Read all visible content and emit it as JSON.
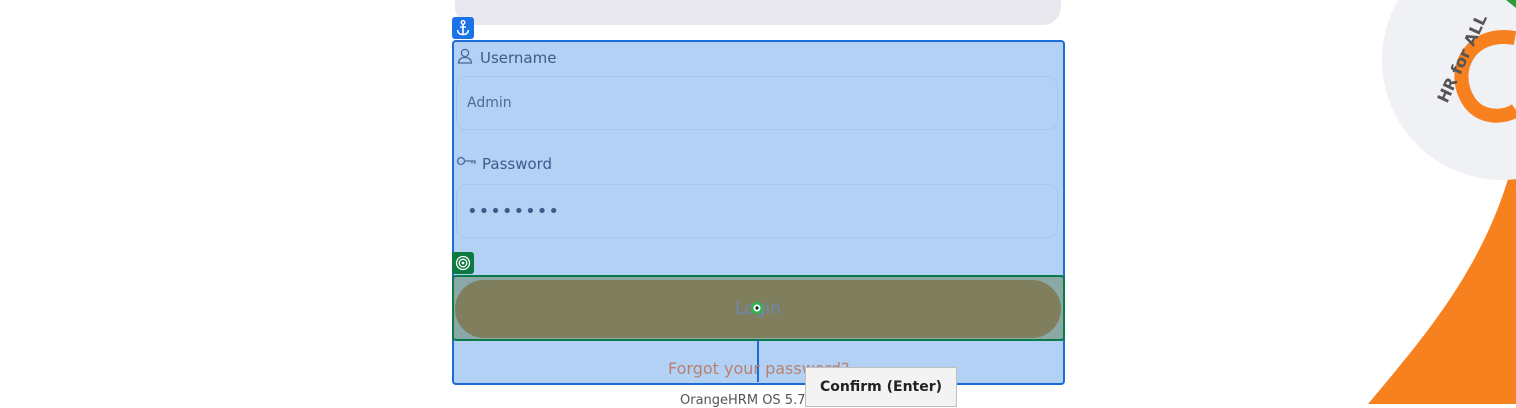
{
  "login": {
    "username_label": "Username",
    "username_value": "Admin",
    "password_label": "Password",
    "password_value": "••••••••",
    "login_button_label": "Login",
    "forgot_password_link": "Forgot your password?"
  },
  "tooltip": {
    "text": "Confirm (Enter)"
  },
  "footer": {
    "text": "OrangeHRM OS 5.7"
  },
  "brand": {
    "tagline": "HR for ALL"
  },
  "colors": {
    "brand_orange": "#f7801f",
    "overlay_blue": "#b3d1f5",
    "overlay_border": "#1d6bd6",
    "target_green": "#0a7a3f"
  },
  "icons": {
    "anchor": "anchor-icon",
    "username": "user-icon",
    "password": "key-icon",
    "target": "target-icon"
  }
}
